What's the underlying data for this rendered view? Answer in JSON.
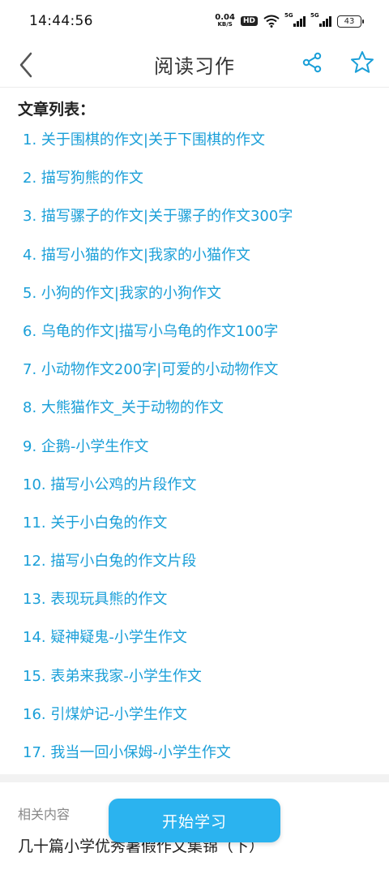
{
  "status_bar": {
    "time": "14:44:56",
    "net_speed": "0.04",
    "net_unit": "KB/S",
    "hd_badge": "HD",
    "signal1_label": "5G",
    "signal2_label": "5G",
    "battery": "43"
  },
  "nav": {
    "title": "阅读习作"
  },
  "list": {
    "header": "文章列表：",
    "items": [
      "1. 关于围棋的作文|关于下围棋的作文",
      "2. 描写狗熊的作文",
      "3. 描写骡子的作文|关于骡子的作文300字",
      "4. 描写小猫的作文|我家的小猫作文",
      "5. 小狗的作文|我家的小狗作文",
      "6. 乌龟的作文|描写小乌龟的作文100字",
      "7. 小动物作文200字|可爱的小动物作文",
      "8. 大熊猫作文_关于动物的作文",
      "9. 企鹅-小学生作文",
      "10. 描写小公鸡的片段作文",
      "11. 关于小白兔的作文",
      "12. 描写小白兔的作文片段",
      "13. 表现玩具熊的作文",
      "14. 疑神疑鬼-小学生作文",
      "15. 表弟来我家-小学生作文",
      "16. 引煤炉记-小学生作文",
      "17. 我当一回小保姆-小学生作文"
    ]
  },
  "related": {
    "label": "相关内容",
    "first_item": "几十篇小学优秀暑假作文集锦（下）"
  },
  "start_button": "开始学习",
  "colors": {
    "link": "#1a9fd8",
    "accent": "#2bb3ef"
  }
}
